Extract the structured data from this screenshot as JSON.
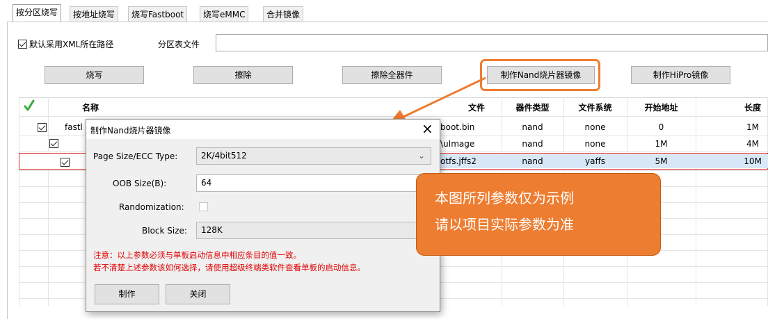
{
  "tabs": [
    "按分区烧写",
    "按地址烧写",
    "烧写Fastboot",
    "烧写eMMC",
    "合并镜像"
  ],
  "options": {
    "use_xml_path_label": "默认采用XML所在路径",
    "partition_file_label": "分区表文件",
    "partition_file_value": ""
  },
  "buttons": {
    "burn": "烧写",
    "erase": "擦除",
    "erase_all": "擦除全器件",
    "make_nand": "制作Nand烧片器镜像",
    "make_hipro": "制作HiPro镜像"
  },
  "table": {
    "columns": [
      "名称",
      "文件",
      "器件类型",
      "文件系统",
      "开始地址",
      "长度"
    ],
    "rows": [
      {
        "name": "fastl",
        "file": "boot.bin",
        "type": "nand",
        "fs": "none",
        "start": "0",
        "length": "1M"
      },
      {
        "name": "",
        "file": "\\uImage",
        "type": "nand",
        "fs": "none",
        "start": "1M",
        "length": "4M"
      },
      {
        "name": "",
        "file": "otfs.jffs2",
        "type": "nand",
        "fs": "yaffs",
        "start": "5M",
        "length": "10M"
      }
    ]
  },
  "dialog": {
    "title": "制作Nand烧片器镜像",
    "close_glyph": "×",
    "page_size_label": "Page Size/ECC Type:",
    "page_size_value": "2K/4bit512",
    "oob_label": "OOB Size(B):",
    "oob_value": "64",
    "randomization_label": "Randomization:",
    "block_label": "Block Size:",
    "block_value": "128K",
    "note_line1": "注意：以上参数必须与单板启动信息中相应条目的值一致。",
    "note_line2": "若不清楚上述参数该如何选择，请使用超级终端类软件查看单板的启动信息。",
    "make_button": "制作",
    "close_button": "关闭"
  },
  "callout": {
    "line1": "本图所列参数仅为示例",
    "line2": "请以项目实际参数为准"
  },
  "colors": {
    "accent": "#ed7d31",
    "warning_text": "#e00000",
    "selected_row_border": "#e03030",
    "header_check": "#3aa93a"
  }
}
